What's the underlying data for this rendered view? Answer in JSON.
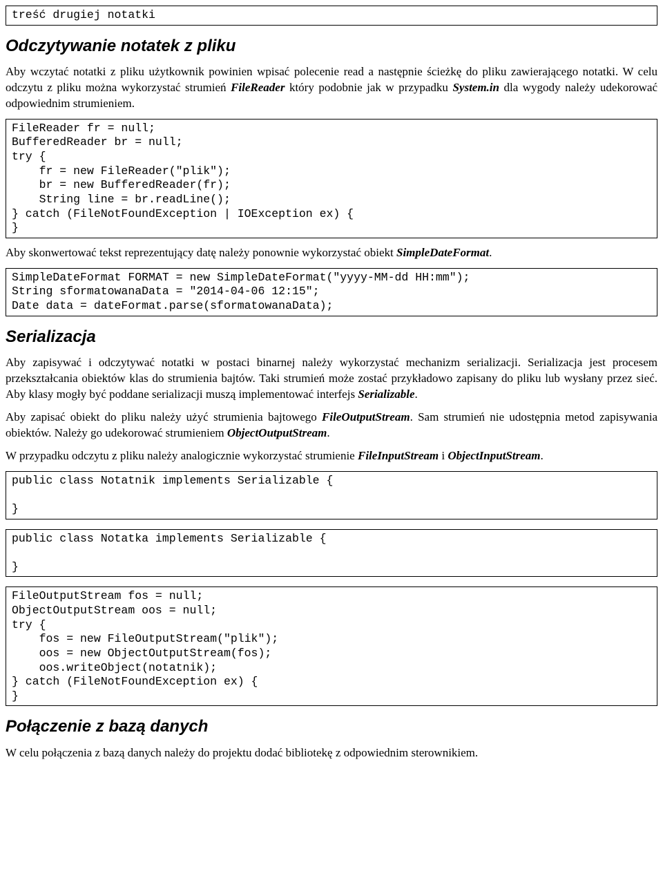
{
  "code_box_1": "treść drugiej notatki",
  "heading_1": "Odczytywanie notatek z pliku",
  "para_1_a": "Aby wczytać notatki z pliku użytkownik powinien wpisać polecenie read a następnie ścieżkę do pliku zawierającego notatki. W celu odczytu z pliku można wykorzystać strumień ",
  "para_1_b": "FileReader",
  "para_1_c": " który podobnie jak w przypadku ",
  "para_1_d": "System.in",
  "para_1_e": " dla wygody należy udekorować odpowiednim strumieniem.",
  "code_box_2": "FileReader fr = null;\nBufferedReader br = null;\ntry {\n    fr = new FileReader(\"plik\");\n    br = new BufferedReader(fr);\n    String line = br.readLine();\n} catch (FileNotFoundException | IOException ex) {\n}",
  "para_2_a": "Aby skonwertować tekst reprezentujący datę należy ponownie wykorzystać obiekt ",
  "para_2_b": "SimpleDateFormat",
  "para_2_c": ".",
  "code_box_3": "SimpleDateFormat FORMAT = new SimpleDateFormat(\"yyyy-MM-dd HH:mm\");\nString sformatowanaData = \"2014-04-06 12:15\";\nDate data = dateFormat.parse(sformatowanaData);",
  "heading_2": "Serializacja",
  "para_3_a": "Aby zapisywać i odczytywać notatki w postaci binarnej należy wykorzystać mechanizm serializacji. Serializacja jest procesem przekształcania obiektów klas do strumienia bajtów. Taki strumień może zostać przykładowo zapisany do pliku lub wysłany przez sieć. Aby klasy mogły być poddane serializacji muszą implementować interfejs ",
  "para_3_b": "Serializable",
  "para_3_c": ".",
  "para_4_a": "Aby zapisać obiekt do pliku należy użyć strumienia bajtowego ",
  "para_4_b": "FileOutputStream",
  "para_4_c": ". Sam strumień nie udostępnia metod zapisywania obiektów. Należy go udekorować strumieniem ",
  "para_4_d": "ObjectOutputStream",
  "para_4_e": ".",
  "para_5_a": "W przypadku odczytu z pliku należy analogicznie wykorzystać strumienie ",
  "para_5_b": "FileInputStream",
  "para_5_c": " i ",
  "para_5_d": "ObjectInputStream",
  "para_5_e": ".",
  "code_box_4": "public class Notatnik implements Serializable {\n\n}",
  "code_box_5": "public class Notatka implements Serializable {\n\n}",
  "code_box_6": "FileOutputStream fos = null;\nObjectOutputStream oos = null;\ntry {\n    fos = new FileOutputStream(\"plik\");\n    oos = new ObjectOutputStream(fos);\n    oos.writeObject(notatnik);\n} catch (FileNotFoundException ex) {\n}",
  "heading_3": "Połączenie z bazą danych",
  "para_6": "W celu połączenia z bazą danych należy do projektu dodać bibliotekę z odpowiednim sterownikiem."
}
